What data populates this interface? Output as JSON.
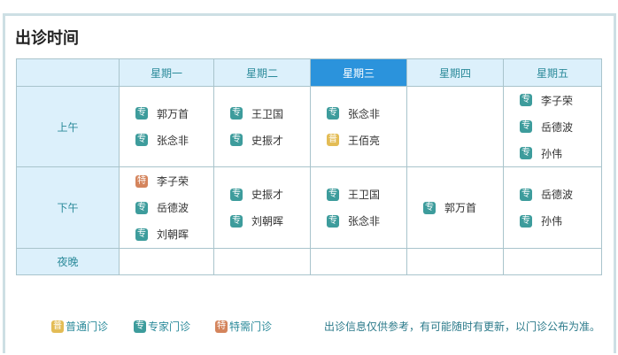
{
  "title": "出诊时间",
  "days": [
    "星期一",
    "星期二",
    "星期三",
    "星期四",
    "星期五"
  ],
  "active_day": "星期三",
  "periods": [
    "上午",
    "下午",
    "夜晚"
  ],
  "schedule": {
    "morning": [
      [
        {
          "t": "专",
          "n": "郭万首"
        },
        {
          "t": "专",
          "n": "张念非"
        }
      ],
      [
        {
          "t": "专",
          "n": "王卫国"
        },
        {
          "t": "专",
          "n": "史振才"
        }
      ],
      [
        {
          "t": "专",
          "n": "张念非"
        },
        {
          "t": "普",
          "n": "王佰亮"
        }
      ],
      [],
      [
        {
          "t": "专",
          "n": "李子荣"
        },
        {
          "t": "专",
          "n": "岳德波"
        },
        {
          "t": "专",
          "n": "孙伟"
        }
      ]
    ],
    "afternoon": [
      [
        {
          "t": "特",
          "n": "李子荣"
        },
        {
          "t": "专",
          "n": "岳德波"
        },
        {
          "t": "专",
          "n": "刘朝晖"
        }
      ],
      [
        {
          "t": "专",
          "n": "史振才"
        },
        {
          "t": "专",
          "n": "刘朝晖"
        }
      ],
      [
        {
          "t": "专",
          "n": "王卫国"
        },
        {
          "t": "专",
          "n": "张念非"
        }
      ],
      [
        {
          "t": "专",
          "n": "郭万首"
        }
      ],
      [
        {
          "t": "专",
          "n": "岳德波"
        },
        {
          "t": "专",
          "n": "孙伟"
        }
      ]
    ],
    "night": [
      [],
      [],
      [],
      [],
      []
    ]
  },
  "legend": [
    {
      "badge": "普",
      "label": "普通门诊",
      "color": "#e3bc55"
    },
    {
      "badge": "专",
      "label": "专家门诊",
      "color": "#3d9c9c"
    },
    {
      "badge": "特",
      "label": "特需门诊",
      "color": "#d4845c"
    }
  ],
  "note": "出诊信息仅供参考，有可能随时有更新，以门诊公布为准。"
}
